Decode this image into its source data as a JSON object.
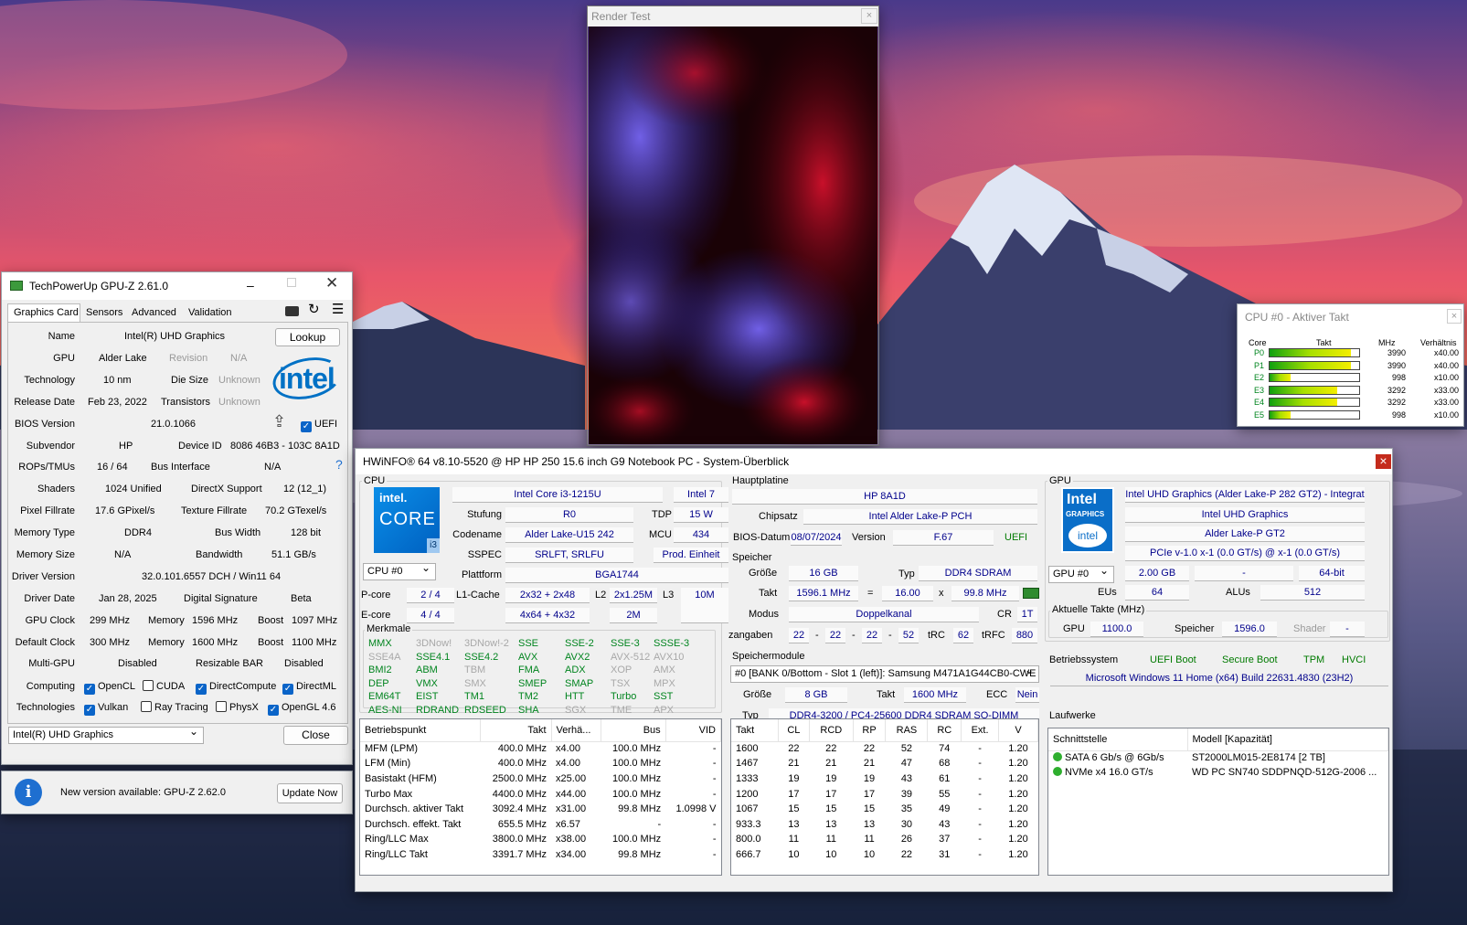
{
  "render_test": {
    "title": "Render Test",
    "close": "×"
  },
  "cpu_monitor": {
    "title": "CPU #0 - Aktiver Takt",
    "close": "×",
    "headers": [
      "Core",
      "Takt",
      "MHz",
      "Verhältnis"
    ],
    "rows": [
      {
        "core": "P0",
        "mhz": "3990",
        "ratio": "x40.00",
        "level": 0.91
      },
      {
        "core": "P1",
        "mhz": "3990",
        "ratio": "x40.00",
        "level": 0.91
      },
      {
        "core": "E2",
        "mhz": "998",
        "ratio": "x10.00",
        "level": 0.23
      },
      {
        "core": "E3",
        "mhz": "3292",
        "ratio": "x33.00",
        "level": 0.75
      },
      {
        "core": "E4",
        "mhz": "3292",
        "ratio": "x33.00",
        "level": 0.75
      },
      {
        "core": "E5",
        "mhz": "998",
        "ratio": "x10.00",
        "level": 0.23
      }
    ]
  },
  "gpuz": {
    "title": "TechPowerUp GPU-Z 2.61.0",
    "tabs": [
      "Graphics Card",
      "Sensors",
      "Advanced",
      "Validation"
    ],
    "name_label": "Name",
    "name": "Intel(R) UHD Graphics",
    "lookup": "Lookup",
    "gpu_label": "GPU",
    "gpu": "Alder Lake",
    "revision_label": "Revision",
    "revision": "N/A",
    "tech_label": "Technology",
    "tech": "10 nm",
    "die_label": "Die Size",
    "die": "Unknown",
    "release_label": "Release Date",
    "release": "Feb 23, 2022",
    "trans_label": "Transistors",
    "trans": "Unknown",
    "bios_label": "BIOS Version",
    "bios": "21.0.1066",
    "uefi": "UEFI",
    "subvendor_label": "Subvendor",
    "subvendor": "HP",
    "devid_label": "Device ID",
    "devid": "8086 46B3 - 103C 8A1D",
    "rops_label": "ROPs/TMUs",
    "rops": "16 / 64",
    "bus_label": "Bus Interface",
    "bus": "N/A",
    "help": "?",
    "shaders_label": "Shaders",
    "shaders": "1024 Unified",
    "dx_label": "DirectX Support",
    "dx": "12 (12_1)",
    "pix_label": "Pixel Fillrate",
    "pix": "17.6 GPixel/s",
    "tex_label": "Texture Fillrate",
    "tex": "70.2 GTexel/s",
    "memtype_label": "Memory Type",
    "memtype": "DDR4",
    "buswidth_label": "Bus Width",
    "buswidth": "128 bit",
    "memsize_label": "Memory Size",
    "memsize": "N/A",
    "bandwidth_label": "Bandwidth",
    "bandwidth": "51.1 GB/s",
    "driver_label": "Driver Version",
    "driver": "32.0.101.6557 DCH / Win11 64",
    "drvdate_label": "Driver Date",
    "drvdate": "Jan 28, 2025",
    "sig_label": "Digital Signature",
    "sig": "Beta",
    "gpuclock_label": "GPU Clock",
    "gpuclock": "299 MHz",
    "mem1_label": "Memory",
    "mem1": "1596 MHz",
    "boost1_label": "Boost",
    "boost1": "1097 MHz",
    "defclock_label": "Default Clock",
    "defclock": "300 MHz",
    "mem2_label": "Memory",
    "mem2": "1600 MHz",
    "boost2_label": "Boost",
    "boost2": "1100 MHz",
    "multigpu_label": "Multi-GPU",
    "multigpu": "Disabled",
    "rebar_label": "Resizable BAR",
    "rebar": "Disabled",
    "computing_label": "Computing",
    "opencl": "OpenCL",
    "cuda": "CUDA",
    "directcompute": "DirectCompute",
    "directml": "DirectML",
    "tech2_label": "Technologies",
    "vulkan": "Vulkan",
    "raytracing": "Ray Tracing",
    "physx": "PhysX",
    "opengl": "OpenGL 4.6",
    "select": "Intel(R) UHD Graphics",
    "close_btn": "Close",
    "update_msg": "New version available: GPU-Z 2.62.0",
    "update_btn": "Update Now",
    "logo": "intel"
  },
  "hwinfo": {
    "title": "HWiNFO® 64 v8.10-5520 @ HP HP 250 15.6 inch G9 Notebook PC - System-Überblick",
    "close": "×",
    "cpu": {
      "group": "CPU",
      "model": "Intel Core i3-1215U",
      "brand": "Intel 7",
      "stufung_label": "Stufung",
      "stufung": "R0",
      "tdp_label": "TDP",
      "tdp": "15 W",
      "codename_label": "Codename",
      "codename": "Alder Lake-U15 242",
      "mcu_label": "MCU",
      "mcu": "434",
      "sspec_label": "SSPEC",
      "sspec": "SRLFT, SRLFU",
      "prod": "Prod. Einheit",
      "select": "CPU #0",
      "plattform_label": "Plattform",
      "plattform": "BGA1744",
      "pcore_label": "P-core",
      "pcore": "2 / 4",
      "l1_label": "L1-Cache",
      "l1p": "2x32 + 2x48",
      "l2_label": "L2",
      "l2p": "2x1.25M",
      "l3_label": "L3",
      "l3": "10M",
      "ecore_label": "E-core",
      "ecore": "4 / 4",
      "l1e": "4x64 + 4x32",
      "l2e": "2M",
      "merkmale": "Merkmale",
      "logo_top": "intel.",
      "logo_mid": "CORE",
      "logo_bot": "i3"
    },
    "features": [
      [
        "MMX",
        "3DNow!",
        "3DNow!-2",
        "SSE",
        "SSE-2",
        "SSE-3",
        "SSSE-3"
      ],
      [
        "SSE4A",
        "SSE4.1",
        "SSE4.2",
        "AVX",
        "AVX2",
        "AVX-512",
        "AVX10"
      ],
      [
        "BMI2",
        "ABM",
        "TBM",
        "FMA",
        "ADX",
        "XOP",
        "AMX"
      ],
      [
        "DEP",
        "VMX",
        "SMX",
        "SMEP",
        "SMAP",
        "TSX",
        "MPX"
      ],
      [
        "EM64T",
        "EIST",
        "TM1",
        "TM2",
        "HTT",
        "Turbo",
        "SST"
      ],
      [
        "AES-NI",
        "RDRAND",
        "RDSEED",
        "SHA",
        "SGX",
        "TME",
        "APX"
      ]
    ],
    "feature_on": [
      [
        1,
        0,
        0,
        1,
        1,
        1,
        1
      ],
      [
        0,
        1,
        1,
        1,
        1,
        0,
        0
      ],
      [
        1,
        1,
        0,
        1,
        1,
        0,
        0
      ],
      [
        1,
        1,
        0,
        1,
        1,
        0,
        0
      ],
      [
        1,
        1,
        1,
        1,
        1,
        1,
        1
      ],
      [
        1,
        1,
        1,
        1,
        0,
        0,
        0
      ]
    ],
    "op_headers": [
      "Betriebspunkt",
      "Takt",
      "Verhä...",
      "Bus",
      "VID"
    ],
    "op_rows": [
      [
        "MFM (LPM)",
        "400.0 MHz",
        "x4.00",
        "100.0 MHz",
        "-"
      ],
      [
        "LFM (Min)",
        "400.0 MHz",
        "x4.00",
        "100.0 MHz",
        "-"
      ],
      [
        "Basistakt (HFM)",
        "2500.0 MHz",
        "x25.00",
        "100.0 MHz",
        "-"
      ],
      [
        "Turbo Max",
        "4400.0 MHz",
        "x44.00",
        "100.0 MHz",
        "-"
      ],
      [
        "Durchsch. aktiver Takt",
        "3092.4 MHz",
        "x31.00",
        "99.8 MHz",
        "1.0998 V"
      ],
      [
        "Durchsch. effekt. Takt",
        "655.5 MHz",
        "x6.57",
        "-",
        "-"
      ],
      [
        "Ring/LLC Max",
        "3800.0 MHz",
        "x38.00",
        "100.0 MHz",
        "-"
      ],
      [
        "Ring/LLC Takt",
        "3391.7 MHz",
        "x34.00",
        "99.8 MHz",
        "-"
      ]
    ],
    "mb": {
      "group": "Hauptplatine",
      "board": "HP 8A1D",
      "chipset_label": "Chipsatz",
      "chipset": "Intel Alder Lake-P PCH",
      "biosdate_label": "BIOS-Datum",
      "biosdate": "08/07/2024",
      "version_label": "Version",
      "version": "F.67",
      "uefi": "UEFI"
    },
    "mem": {
      "group": "Speicher",
      "size_label": "Größe",
      "size": "16 GB",
      "typ_label": "Typ",
      "typ": "DDR4 SDRAM",
      "takt_label": "Takt",
      "takt": "1596.1 MHz",
      "eq": "=",
      "mult": "16.00",
      "x": "x",
      "bus": "99.8 MHz",
      "modus_label": "Modus",
      "modus": "Doppelkanal",
      "cr_label": "CR",
      "cr": "1T",
      "timings_label": "zangaben",
      "t1": "22",
      "t2": "22",
      "t3": "22",
      "t4": "52",
      "trc_label": "tRC",
      "trc": "62",
      "trfc_label": "tRFC",
      "trfc": "880",
      "dash": "-"
    },
    "mod": {
      "group": "Speichermodule",
      "select": "#0 [BANK 0/Bottom - Slot 1 (left)]: Samsung M471A1G44CB0-CWE",
      "size_label": "Größe",
      "size": "8 GB",
      "takt_label": "Takt",
      "takt": "1600 MHz",
      "ecc_label": "ECC",
      "ecc": "Nein",
      "typ_label": "Typ",
      "typ": "DDR4-3200 / PC4-25600 DDR4 SDRAM SO-DIMM"
    },
    "timing_headers": [
      "Takt",
      "CL",
      "RCD",
      "RP",
      "RAS",
      "RC",
      "Ext.",
      "V"
    ],
    "timing_rows": [
      [
        "1600",
        "22",
        "22",
        "22",
        "52",
        "74",
        "-",
        "1.20"
      ],
      [
        "1467",
        "21",
        "21",
        "21",
        "47",
        "68",
        "-",
        "1.20"
      ],
      [
        "1333",
        "19",
        "19",
        "19",
        "43",
        "61",
        "-",
        "1.20"
      ],
      [
        "1200",
        "17",
        "17",
        "17",
        "39",
        "55",
        "-",
        "1.20"
      ],
      [
        "1067",
        "15",
        "15",
        "15",
        "35",
        "49",
        "-",
        "1.20"
      ],
      [
        "933.3",
        "13",
        "13",
        "13",
        "30",
        "43",
        "-",
        "1.20"
      ],
      [
        "800.0",
        "11",
        "11",
        "11",
        "26",
        "37",
        "-",
        "1.20"
      ],
      [
        "666.7",
        "10",
        "10",
        "10",
        "22",
        "31",
        "-",
        "1.20"
      ]
    ],
    "gpu": {
      "group": "GPU",
      "name": "Intel UHD Graphics (Alder Lake-P 282 GT2) - Integrat",
      "name2": "Intel UHD Graphics",
      "name3": "Alder Lake-P GT2",
      "pcie": "PCIe v-1.0 x-1 (0.0 GT/s) @ x-1 (0.0 GT/s)",
      "select": "GPU #0",
      "mem": "2.00 GB",
      "dash": "-",
      "bits": "64-bit",
      "eus_label": "EUs",
      "eus": "64",
      "alus_label": "ALUs",
      "alus": "512",
      "clocks_label": "Aktuelle Takte (MHz)",
      "gpu_label": "GPU",
      "gpu_clock": "1100.0",
      "speicher_label": "Speicher",
      "speicher": "1596.0",
      "shader_label": "Shader",
      "shader": "-",
      "logo_top": "Intel",
      "logo_mid": "GRAPHICS",
      "logo_bot": "intel"
    },
    "os": {
      "label": "Betriebssystem",
      "uefi_boot": "UEFI Boot",
      "secure_boot": "Secure Boot",
      "tpm": "TPM",
      "hvci": "HVCI",
      "name": "Microsoft Windows 11 Home (x64) Build 22631.4830 (23H2)"
    },
    "drives": {
      "label": "Laufwerke",
      "headers": [
        "Schnittstelle",
        "Modell [Kapazität]"
      ],
      "rows": [
        [
          "SATA 6 Gb/s @ 6Gb/s",
          "ST2000LM015-2E8174 [2 TB]"
        ],
        [
          "NVMe x4 16.0 GT/s",
          "WD PC SN740 SDDPNQD-512G-2006 ..."
        ]
      ]
    }
  }
}
